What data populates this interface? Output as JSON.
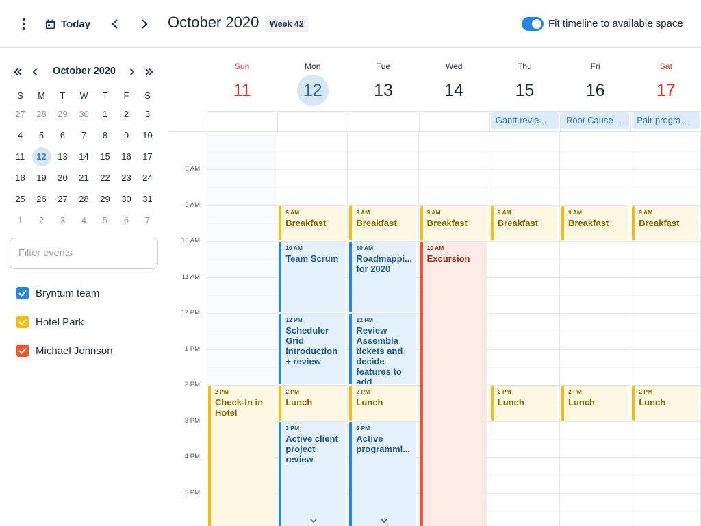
{
  "toolbar": {
    "today_label": "Today",
    "title": "October 2020",
    "week_badge": "Week 42",
    "fit_timeline_label": "Fit timeline to available space",
    "fit_timeline_on": true
  },
  "mini_calendar": {
    "title": "October 2020",
    "weekdays": [
      "S",
      "M",
      "T",
      "W",
      "T",
      "F",
      "S"
    ],
    "weeks": [
      [
        "27",
        "28",
        "29",
        "30",
        "1",
        "2",
        "3"
      ],
      [
        "4",
        "5",
        "6",
        "7",
        "8",
        "9",
        "10"
      ],
      [
        "11",
        "12",
        "13",
        "14",
        "15",
        "16",
        "17"
      ],
      [
        "18",
        "19",
        "20",
        "21",
        "22",
        "23",
        "24"
      ],
      [
        "25",
        "26",
        "27",
        "28",
        "29",
        "30",
        "31"
      ],
      [
        "1",
        "2",
        "3",
        "4",
        "5",
        "6",
        "7"
      ]
    ],
    "selected_day": "12"
  },
  "filter": {
    "placeholder": "Filter events",
    "value": ""
  },
  "resources": [
    {
      "name": "Bryntum team",
      "color": "#2784e0",
      "checked": true
    },
    {
      "name": "Hotel Park",
      "color": "#f5bd12",
      "checked": true
    },
    {
      "name": "Michael Johnson",
      "color": "#f0562d",
      "checked": true
    }
  ],
  "days": [
    {
      "dow": "Sun",
      "date": "11",
      "weekend": true
    },
    {
      "dow": "Mon",
      "date": "12",
      "today": true
    },
    {
      "dow": "Tue",
      "date": "13"
    },
    {
      "dow": "Wed",
      "date": "14"
    },
    {
      "dow": "Thu",
      "date": "15"
    },
    {
      "dow": "Fri",
      "date": "16"
    },
    {
      "dow": "Sat",
      "date": "17",
      "weekend": true
    }
  ],
  "all_day_events": [
    {
      "day": 4,
      "name": "Gantt revie..."
    },
    {
      "day": 5,
      "name": "Root Cause ..."
    },
    {
      "day": 6,
      "name": "Pair progra..."
    }
  ],
  "time_labels": [
    "8 AM",
    "9 AM",
    "10 AM",
    "11 AM",
    "12 PM",
    "1 PM",
    "2 PM",
    "3 PM",
    "4 PM",
    "5 PM"
  ],
  "events": [
    {
      "day": 1,
      "start": 9,
      "end": 10,
      "time": "9 AM",
      "name": "Breakfast",
      "color": "yellow"
    },
    {
      "day": 2,
      "start": 9,
      "end": 10,
      "time": "9 AM",
      "name": "Breakfast",
      "color": "yellow"
    },
    {
      "day": 3,
      "start": 9,
      "end": 10,
      "time": "9 AM",
      "name": "Breakfast",
      "color": "yellow"
    },
    {
      "day": 4,
      "start": 9,
      "end": 10,
      "time": "9 AM",
      "name": "Breakfast",
      "color": "yellow"
    },
    {
      "day": 5,
      "start": 9,
      "end": 10,
      "time": "9 AM",
      "name": "Breakfast",
      "color": "yellow"
    },
    {
      "day": 6,
      "start": 9,
      "end": 10,
      "time": "9 AM",
      "name": "Breakfast",
      "color": "yellow"
    },
    {
      "day": 1,
      "start": 10,
      "end": 12,
      "time": "10 AM",
      "name": "Team Scrum",
      "color": "blue"
    },
    {
      "day": 2,
      "start": 10,
      "end": 12,
      "time": "10 AM",
      "name": "Roadmappi... for 2020",
      "color": "blue"
    },
    {
      "day": 3,
      "start": 10,
      "end": 18,
      "time": "10 AM",
      "name": "Excursion",
      "color": "red"
    },
    {
      "day": 1,
      "start": 12,
      "end": 14,
      "time": "12 PM",
      "name": "Scheduler Grid introduction + review",
      "color": "blue"
    },
    {
      "day": 2,
      "start": 12,
      "end": 14,
      "time": "12 PM",
      "name": "Review Assembla tickets and decide features to add",
      "color": "blue"
    },
    {
      "day": 0,
      "start": 14,
      "end": 18,
      "time": "2 PM",
      "name": "Check-In in Hotel",
      "color": "yellow"
    },
    {
      "day": 1,
      "start": 14,
      "end": 15,
      "time": "2 PM",
      "name": "Lunch",
      "color": "yellow"
    },
    {
      "day": 2,
      "start": 14,
      "end": 15,
      "time": "2 PM",
      "name": "Lunch",
      "color": "yellow"
    },
    {
      "day": 4,
      "start": 14,
      "end": 15,
      "time": "2 PM",
      "name": "Lunch",
      "color": "yellow"
    },
    {
      "day": 5,
      "start": 14,
      "end": 15,
      "time": "2 PM",
      "name": "Lunch",
      "color": "yellow"
    },
    {
      "day": 6,
      "start": 14,
      "end": 15,
      "time": "2 PM",
      "name": "Lunch",
      "color": "yellow"
    },
    {
      "day": 1,
      "start": 15,
      "end": 18,
      "time": "3 PM",
      "name": "Active client project review",
      "color": "blue",
      "more": true
    },
    {
      "day": 2,
      "start": 15,
      "end": 18,
      "time": "3 PM",
      "name": "Active programmi...",
      "color": "blue",
      "more": true
    }
  ]
}
